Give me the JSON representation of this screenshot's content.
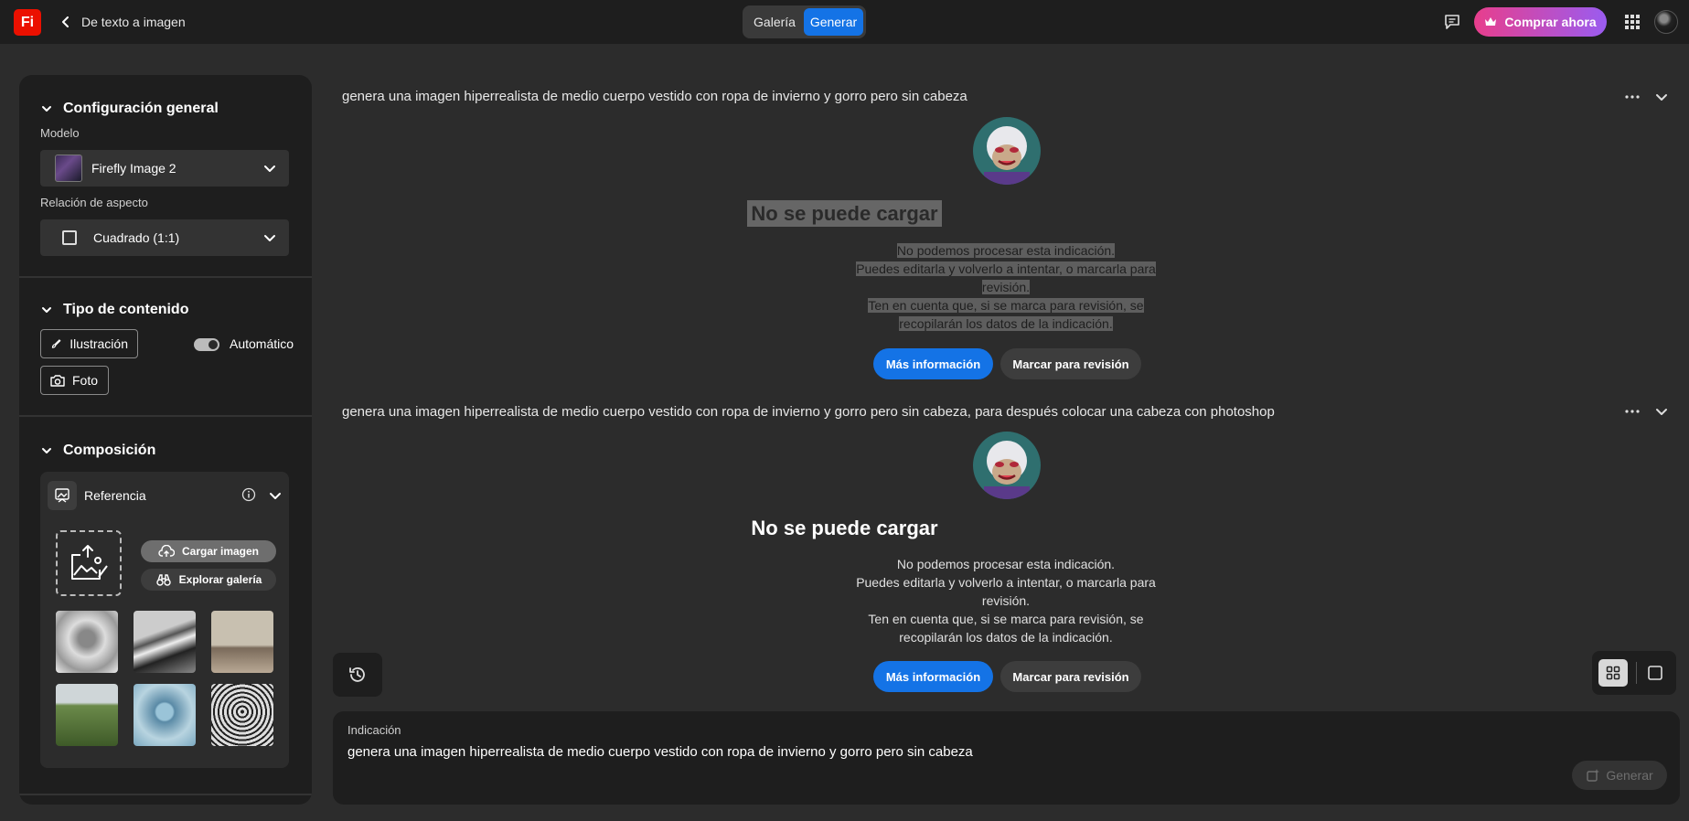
{
  "app": {
    "logo_text": "Fi",
    "title": "De texto a imagen"
  },
  "tabs": {
    "gallery": "Galería",
    "generate": "Generar"
  },
  "header": {
    "buy_label": "Comprar ahora"
  },
  "colors": {
    "accent": "#1473e6",
    "logo_red": "#eb1000",
    "buy_gradient_start": "#e83e8c",
    "buy_gradient_end": "#9a5cf0"
  },
  "sidebar": {
    "general": {
      "title": "Configuración general",
      "model_label": "Modelo",
      "model_value": "Firefly Image 2",
      "aspect_label": "Relación de aspecto",
      "aspect_value": "Cuadrado (1:1)"
    },
    "content_type": {
      "title": "Tipo de contenido",
      "illustration": "Ilustración",
      "photo": "Foto",
      "auto_label": "Automático",
      "auto_on": true
    },
    "composition": {
      "title": "Composición",
      "reference_title": "Referencia",
      "upload_label": "Cargar imagen",
      "explore_label": "Explorar galería"
    }
  },
  "feed": {
    "items": [
      {
        "prompt": "genera una imagen hiperrealista de medio cuerpo vestido con ropa de invierno y gorro pero sin cabeza",
        "error_title": "No se puede cargar",
        "error_lines": [
          "No podemos procesar esta indicación.",
          "Puedes editarla y volverlo a intentar, o marcarla para",
          "revisión.",
          "Ten en cuenta que, si se marca para revisión, se",
          "recopilarán los datos de la indicación."
        ],
        "more_info": "Más información",
        "flag": "Marcar para revisión"
      },
      {
        "prompt": "genera una imagen hiperrealista de medio cuerpo vestido con ropa de invierno y gorro pero sin cabeza, para después colocar una cabeza con photoshop",
        "error_title": "No se puede cargar",
        "error_lines": [
          "No podemos procesar esta indicación.",
          "Puedes editarla y volverlo a intentar, o marcarla para",
          "revisión.",
          "Ten en cuenta que, si se marca para revisión, se",
          "recopilarán los datos de la indicación."
        ],
        "more_info": "Más información",
        "flag": "Marcar para revisión"
      }
    ]
  },
  "prompt_box": {
    "label": "Indicación",
    "value": "genera una imagen hiperrealista de medio cuerpo vestido con ropa de invierno y gorro pero sin cabeza",
    "generate": "Generar"
  }
}
